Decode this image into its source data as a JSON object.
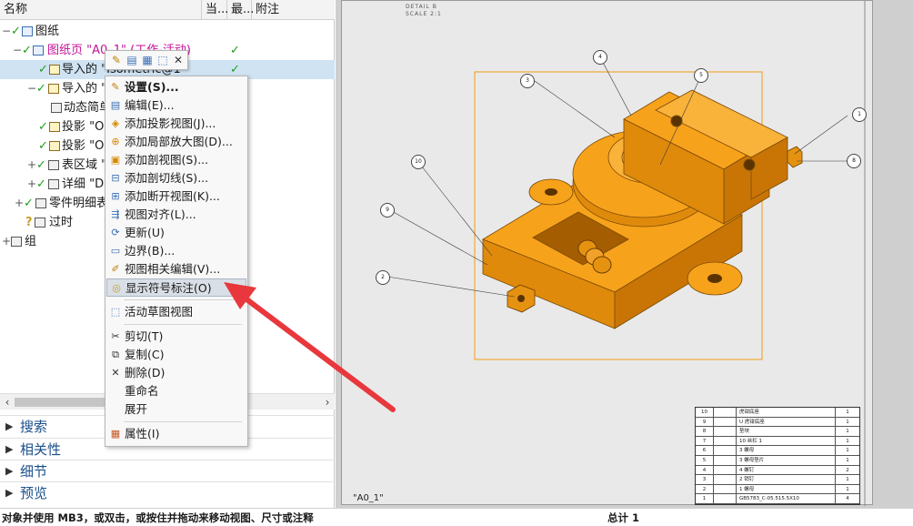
{
  "nav": {
    "columns": [
      "名称",
      "当...",
      "最...",
      "附注"
    ],
    "rows": [
      {
        "label": "图纸",
        "marker": "",
        "icon": "drawing-icon"
      },
      {
        "label": "图纸页 \"A0_1\" (工作-活动)",
        "marker": "✓",
        "icon": "sheet-icon"
      },
      {
        "label": "导入的 \"Isometric@1\"",
        "marker": "✓",
        "icon": "view-icon"
      },
      {
        "label": "导入的 \"",
        "marker": "",
        "icon": "view-icon"
      },
      {
        "label": "动态简单",
        "marker": "",
        "icon": "section-icon"
      },
      {
        "label": "投影 \"O",
        "marker": "",
        "icon": "projection-icon"
      },
      {
        "label": "投影 \"O",
        "marker": "",
        "icon": "projection-icon"
      },
      {
        "label": "表区域 \"",
        "marker": "",
        "icon": "table-icon"
      },
      {
        "label": "详细 \"D",
        "marker": "",
        "icon": "detail-icon"
      },
      {
        "label": "零件明细表",
        "marker": "",
        "icon": "parts-list-icon"
      },
      {
        "label": "过时",
        "marker": "",
        "icon": "outdated-icon"
      },
      {
        "label": "组",
        "marker": "",
        "icon": "group-icon"
      }
    ]
  },
  "panels": [
    "搜索",
    "相关性",
    "细节",
    "预览"
  ],
  "mini_toolbar": [
    "pencil-icon",
    "edit-view-icon",
    "view-style-icon",
    "dashed-box-icon",
    "close-icon"
  ],
  "context_menu": [
    {
      "label": "设置(S)...",
      "icon": "pencil-icon",
      "bold": true
    },
    {
      "label": "编辑(E)...",
      "icon": "edit-icon"
    },
    {
      "label": "添加投影视图(J)...",
      "icon": "projection-view-icon"
    },
    {
      "label": "添加局部放大图(D)...",
      "icon": "detail-view-icon"
    },
    {
      "label": "添加剖视图(S)...",
      "icon": "section-view-icon"
    },
    {
      "label": "添加剖切线(S)...",
      "icon": "section-line-icon"
    },
    {
      "label": "添加断开视图(K)...",
      "icon": "break-view-icon"
    },
    {
      "label": "视图对齐(L)...",
      "icon": "align-icon"
    },
    {
      "label": "更新(U)",
      "icon": "update-icon"
    },
    {
      "label": "边界(B)...",
      "icon": "boundary-icon"
    },
    {
      "label": "视图相关编辑(V)...",
      "icon": "view-edit-icon"
    },
    {
      "label": "显示符号标注(O)",
      "icon": "symbol-icon",
      "highlight": true
    },
    {
      "label": "活动草图视图",
      "icon": "sketch-view-icon"
    },
    {
      "label": "剪切(T)",
      "icon": "cut-icon"
    },
    {
      "label": "复制(C)",
      "icon": "copy-icon"
    },
    {
      "label": "删除(D)",
      "icon": "delete-icon"
    },
    {
      "label": "重命名",
      "icon": ""
    },
    {
      "label": "展开",
      "icon": ""
    },
    {
      "label": "属性(I)",
      "icon": "properties-icon"
    }
  ],
  "drawing": {
    "sheet_label": "\"A0_1\"",
    "detail_note": "DETAIL B",
    "detail_scale": "SCALE 2:1",
    "balloons": [
      "1",
      "2",
      "3",
      "4",
      "5",
      "7",
      "8",
      "9",
      "10"
    ],
    "parts_list": [
      {
        "no": "10",
        "name": "虎钳底座",
        "qty": "1"
      },
      {
        "no": "9",
        "name": "U 虎钳底座",
        "qty": "1"
      },
      {
        "no": "8",
        "name": "垫块",
        "qty": "1"
      },
      {
        "no": "7",
        "name": "10 丝杠 1",
        "qty": "1"
      },
      {
        "no": "6",
        "name": "3 螺母",
        "qty": "1"
      },
      {
        "no": "5",
        "name": "3 螺母垫片",
        "qty": "1"
      },
      {
        "no": "4",
        "name": "4 螺钉",
        "qty": "2"
      },
      {
        "no": "3",
        "name": "2 销钉",
        "qty": "1"
      },
      {
        "no": "2",
        "name": "1 螺母",
        "qty": "1"
      },
      {
        "no": "1",
        "name": "GB5783_C-05.515.5X10",
        "qty": "4"
      }
    ]
  },
  "status": {
    "hint": "对象并使用 MB3，或双击，或按住并拖动来移动视图、尺寸或注释",
    "total": "总计 1"
  },
  "colors": {
    "part": "#f39c12",
    "part_dark": "#c87309",
    "select": "#cfe3f3",
    "arrow": "#e8383d"
  }
}
